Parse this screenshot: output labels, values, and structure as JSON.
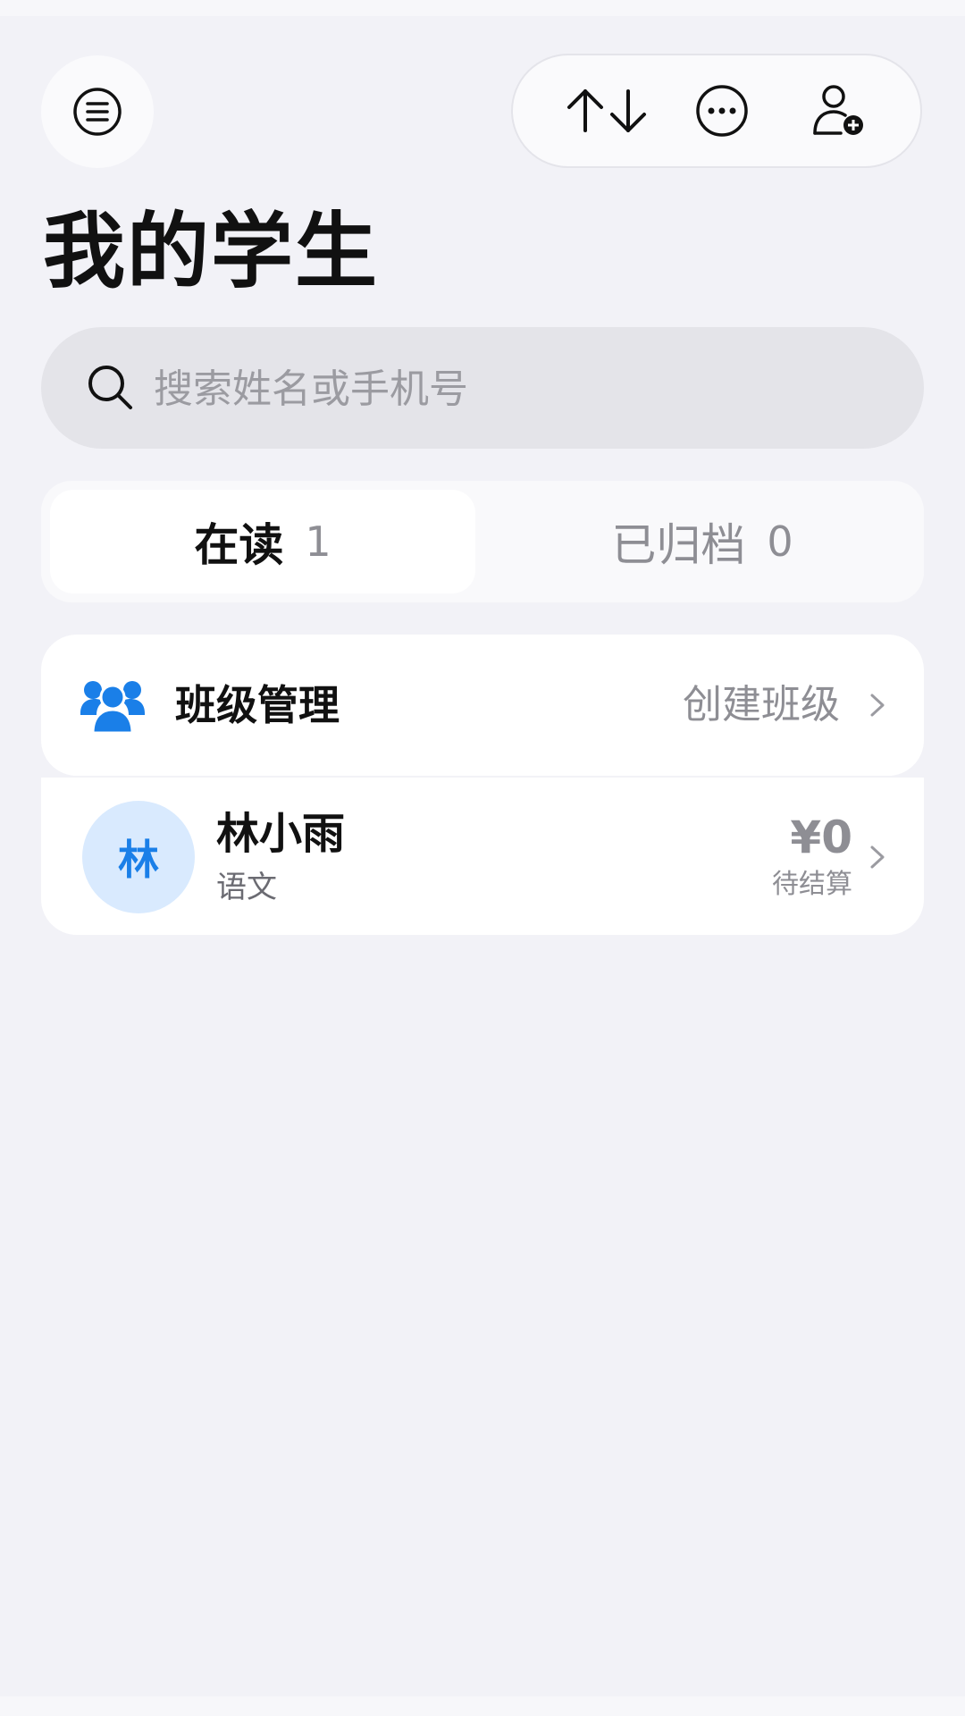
{
  "header": {
    "title": "我的学生"
  },
  "search": {
    "placeholder": "搜索姓名或手机号"
  },
  "tabs": [
    {
      "label": "在读",
      "count": "1",
      "active": true
    },
    {
      "label": "已归档",
      "count": "0",
      "active": false
    }
  ],
  "class_management": {
    "label": "班级管理",
    "action": "创建班级"
  },
  "students": [
    {
      "avatar_text": "林",
      "name": "林小雨",
      "subject": "语文",
      "amount": "¥0",
      "status": "待结算"
    }
  ],
  "colors": {
    "accent": "#1a7fe8",
    "avatar_bg": "#d9eafe",
    "background": "#f2f2f7"
  },
  "icons": {
    "menu": "menu-lines-icon",
    "sort": "sort-arrows-icon",
    "more": "more-dots-icon",
    "add_user": "add-user-icon",
    "search": "search-icon",
    "group": "group-icon",
    "chevron": "chevron-right-icon"
  }
}
